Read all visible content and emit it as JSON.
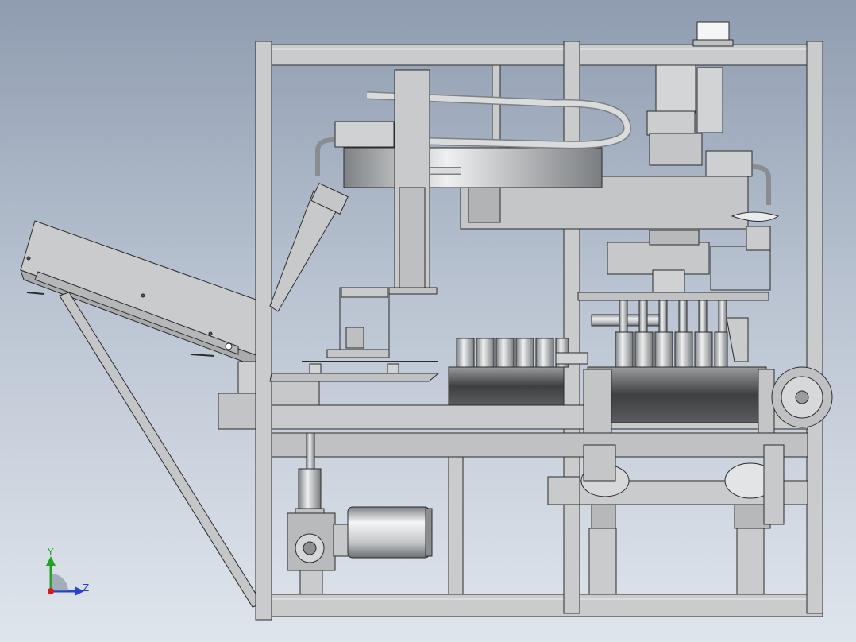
{
  "triad": {
    "y_label": "Y",
    "z_label": "Z",
    "y_color": "#21a321",
    "z_color": "#2a3fd6",
    "origin_color": "#d61a1a"
  },
  "colors": {
    "background_top": "#8f9cb0",
    "background_bottom": "#dfe5ec",
    "frame_fill": "#c9cbcd",
    "frame_stroke": "#2b2b2b",
    "dark_belt": "#4a4a4a",
    "steel_light": "#e4e6e8",
    "steel_dark": "#8a8d90"
  }
}
